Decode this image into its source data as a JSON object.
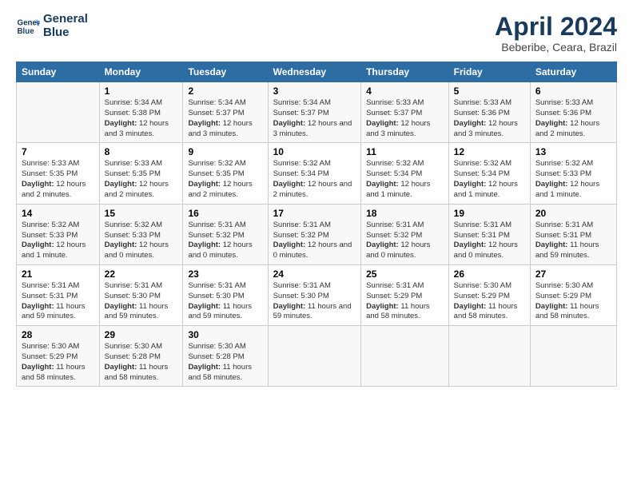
{
  "header": {
    "logo_line1": "General",
    "logo_line2": "Blue",
    "title": "April 2024",
    "subtitle": "Beberibe, Ceara, Brazil"
  },
  "columns": [
    "Sunday",
    "Monday",
    "Tuesday",
    "Wednesday",
    "Thursday",
    "Friday",
    "Saturday"
  ],
  "weeks": [
    [
      {
        "day": "",
        "sunrise": "",
        "sunset": "",
        "daylight": ""
      },
      {
        "day": "1",
        "sunrise": "Sunrise: 5:34 AM",
        "sunset": "Sunset: 5:38 PM",
        "daylight": "Daylight: 12 hours and 3 minutes."
      },
      {
        "day": "2",
        "sunrise": "Sunrise: 5:34 AM",
        "sunset": "Sunset: 5:37 PM",
        "daylight": "Daylight: 12 hours and 3 minutes."
      },
      {
        "day": "3",
        "sunrise": "Sunrise: 5:34 AM",
        "sunset": "Sunset: 5:37 PM",
        "daylight": "Daylight: 12 hours and 3 minutes."
      },
      {
        "day": "4",
        "sunrise": "Sunrise: 5:33 AM",
        "sunset": "Sunset: 5:37 PM",
        "daylight": "Daylight: 12 hours and 3 minutes."
      },
      {
        "day": "5",
        "sunrise": "Sunrise: 5:33 AM",
        "sunset": "Sunset: 5:36 PM",
        "daylight": "Daylight: 12 hours and 3 minutes."
      },
      {
        "day": "6",
        "sunrise": "Sunrise: 5:33 AM",
        "sunset": "Sunset: 5:36 PM",
        "daylight": "Daylight: 12 hours and 2 minutes."
      }
    ],
    [
      {
        "day": "7",
        "sunrise": "Sunrise: 5:33 AM",
        "sunset": "Sunset: 5:35 PM",
        "daylight": "Daylight: 12 hours and 2 minutes."
      },
      {
        "day": "8",
        "sunrise": "Sunrise: 5:33 AM",
        "sunset": "Sunset: 5:35 PM",
        "daylight": "Daylight: 12 hours and 2 minutes."
      },
      {
        "day": "9",
        "sunrise": "Sunrise: 5:32 AM",
        "sunset": "Sunset: 5:35 PM",
        "daylight": "Daylight: 12 hours and 2 minutes."
      },
      {
        "day": "10",
        "sunrise": "Sunrise: 5:32 AM",
        "sunset": "Sunset: 5:34 PM",
        "daylight": "Daylight: 12 hours and 2 minutes."
      },
      {
        "day": "11",
        "sunrise": "Sunrise: 5:32 AM",
        "sunset": "Sunset: 5:34 PM",
        "daylight": "Daylight: 12 hours and 1 minute."
      },
      {
        "day": "12",
        "sunrise": "Sunrise: 5:32 AM",
        "sunset": "Sunset: 5:34 PM",
        "daylight": "Daylight: 12 hours and 1 minute."
      },
      {
        "day": "13",
        "sunrise": "Sunrise: 5:32 AM",
        "sunset": "Sunset: 5:33 PM",
        "daylight": "Daylight: 12 hours and 1 minute."
      }
    ],
    [
      {
        "day": "14",
        "sunrise": "Sunrise: 5:32 AM",
        "sunset": "Sunset: 5:33 PM",
        "daylight": "Daylight: 12 hours and 1 minute."
      },
      {
        "day": "15",
        "sunrise": "Sunrise: 5:32 AM",
        "sunset": "Sunset: 5:33 PM",
        "daylight": "Daylight: 12 hours and 0 minutes."
      },
      {
        "day": "16",
        "sunrise": "Sunrise: 5:31 AM",
        "sunset": "Sunset: 5:32 PM",
        "daylight": "Daylight: 12 hours and 0 minutes."
      },
      {
        "day": "17",
        "sunrise": "Sunrise: 5:31 AM",
        "sunset": "Sunset: 5:32 PM",
        "daylight": "Daylight: 12 hours and 0 minutes."
      },
      {
        "day": "18",
        "sunrise": "Sunrise: 5:31 AM",
        "sunset": "Sunset: 5:32 PM",
        "daylight": "Daylight: 12 hours and 0 minutes."
      },
      {
        "day": "19",
        "sunrise": "Sunrise: 5:31 AM",
        "sunset": "Sunset: 5:31 PM",
        "daylight": "Daylight: 12 hours and 0 minutes."
      },
      {
        "day": "20",
        "sunrise": "Sunrise: 5:31 AM",
        "sunset": "Sunset: 5:31 PM",
        "daylight": "Daylight: 11 hours and 59 minutes."
      }
    ],
    [
      {
        "day": "21",
        "sunrise": "Sunrise: 5:31 AM",
        "sunset": "Sunset: 5:31 PM",
        "daylight": "Daylight: 11 hours and 59 minutes."
      },
      {
        "day": "22",
        "sunrise": "Sunrise: 5:31 AM",
        "sunset": "Sunset: 5:30 PM",
        "daylight": "Daylight: 11 hours and 59 minutes."
      },
      {
        "day": "23",
        "sunrise": "Sunrise: 5:31 AM",
        "sunset": "Sunset: 5:30 PM",
        "daylight": "Daylight: 11 hours and 59 minutes."
      },
      {
        "day": "24",
        "sunrise": "Sunrise: 5:31 AM",
        "sunset": "Sunset: 5:30 PM",
        "daylight": "Daylight: 11 hours and 59 minutes."
      },
      {
        "day": "25",
        "sunrise": "Sunrise: 5:31 AM",
        "sunset": "Sunset: 5:29 PM",
        "daylight": "Daylight: 11 hours and 58 minutes."
      },
      {
        "day": "26",
        "sunrise": "Sunrise: 5:30 AM",
        "sunset": "Sunset: 5:29 PM",
        "daylight": "Daylight: 11 hours and 58 minutes."
      },
      {
        "day": "27",
        "sunrise": "Sunrise: 5:30 AM",
        "sunset": "Sunset: 5:29 PM",
        "daylight": "Daylight: 11 hours and 58 minutes."
      }
    ],
    [
      {
        "day": "28",
        "sunrise": "Sunrise: 5:30 AM",
        "sunset": "Sunset: 5:29 PM",
        "daylight": "Daylight: 11 hours and 58 minutes."
      },
      {
        "day": "29",
        "sunrise": "Sunrise: 5:30 AM",
        "sunset": "Sunset: 5:28 PM",
        "daylight": "Daylight: 11 hours and 58 minutes."
      },
      {
        "day": "30",
        "sunrise": "Sunrise: 5:30 AM",
        "sunset": "Sunset: 5:28 PM",
        "daylight": "Daylight: 11 hours and 58 minutes."
      },
      {
        "day": "",
        "sunrise": "",
        "sunset": "",
        "daylight": ""
      },
      {
        "day": "",
        "sunrise": "",
        "sunset": "",
        "daylight": ""
      },
      {
        "day": "",
        "sunrise": "",
        "sunset": "",
        "daylight": ""
      },
      {
        "day": "",
        "sunrise": "",
        "sunset": "",
        "daylight": ""
      }
    ]
  ]
}
